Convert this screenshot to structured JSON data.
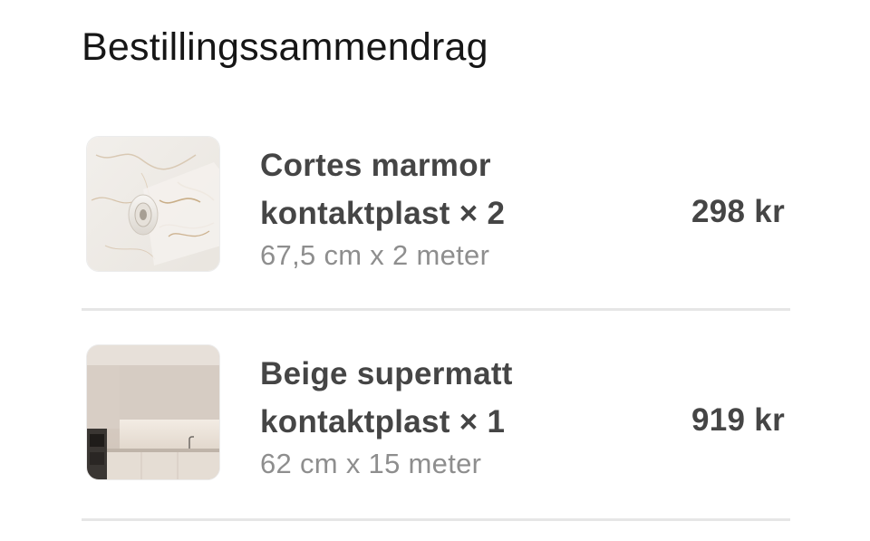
{
  "order_summary": {
    "title": "Bestillingssammendrag",
    "items": [
      {
        "name_line1": "Cortes marmor",
        "name_line2": "kontaktplast × 2",
        "variant": "67,5 cm x 2 meter",
        "price": "298 kr",
        "image": "marble-contact-paper-roll"
      },
      {
        "name_line1": "Beige supermatt",
        "name_line2": "kontaktplast × 1",
        "variant": "62 cm x 15 meter",
        "price": "919 kr",
        "image": "beige-kitchen-interior"
      }
    ]
  }
}
